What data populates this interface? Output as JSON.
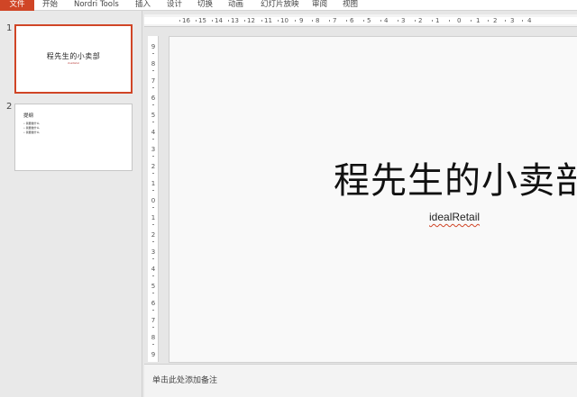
{
  "ribbon": {
    "tabs": [
      "文件",
      "开始",
      "Nordri Tools",
      "插入",
      "设计",
      "切换",
      "动画",
      "幻灯片放映",
      "审阅",
      "视图"
    ]
  },
  "thumbnails": [
    {
      "number": "1",
      "title": "程先生的小卖部",
      "subtitle": "idealRetail"
    },
    {
      "number": "2",
      "title": "提纲",
      "bullets": [
        "我要做什么",
        "我要做什么",
        "我要做什么"
      ]
    }
  ],
  "ruler": {
    "horizontal": [
      "16",
      "15",
      "14",
      "13",
      "12",
      "11",
      "10",
      "9",
      "8",
      "7",
      "6",
      "5",
      "4",
      "3",
      "2",
      "1",
      "0",
      "1",
      "2",
      "3",
      "4"
    ],
    "vertical": [
      "9",
      "8",
      "7",
      "6",
      "5",
      "4",
      "3",
      "2",
      "1",
      "0",
      "1",
      "2",
      "3",
      "4",
      "5",
      "6",
      "7",
      "8",
      "9"
    ]
  },
  "slide": {
    "title": "程先生的小卖部",
    "subtitle": "idealRetail"
  },
  "notes": {
    "placeholder": "单击此处添加备注"
  },
  "colors": {
    "accent": "#d04526"
  }
}
